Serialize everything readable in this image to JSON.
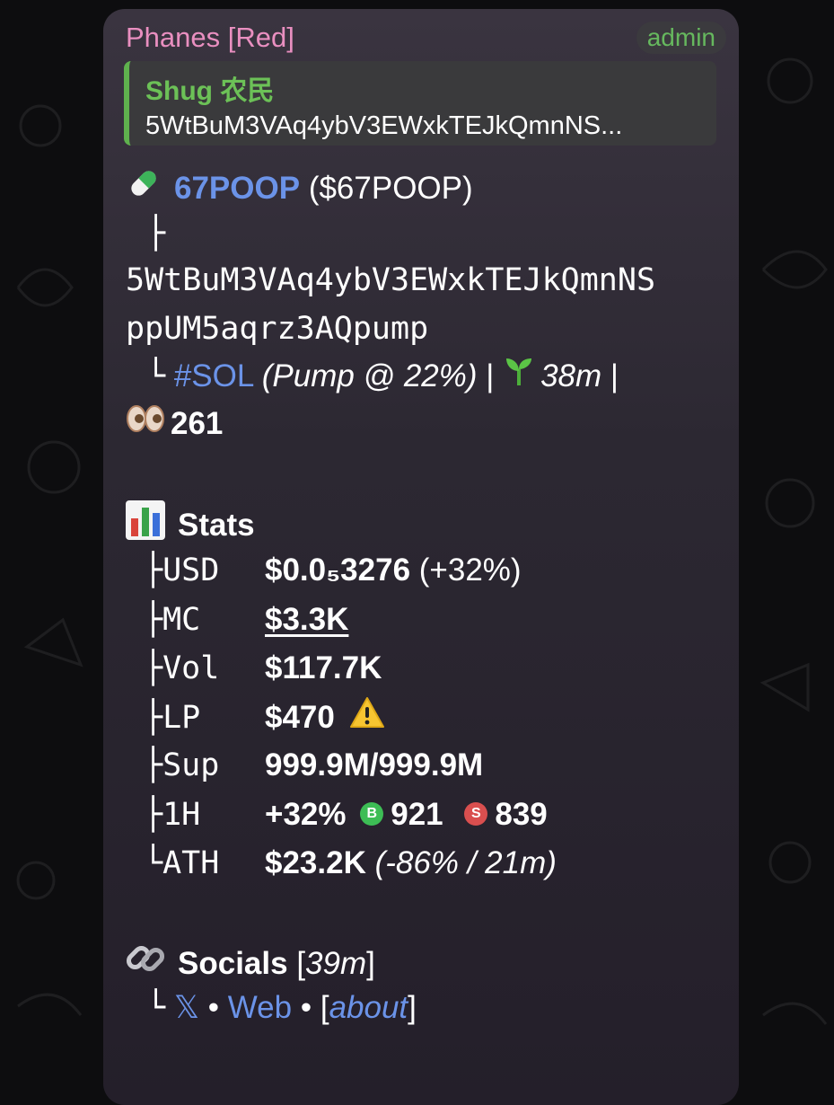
{
  "message": {
    "sender": "Phanes [Red]",
    "badge": "admin",
    "reply": {
      "name": "Shug 农民",
      "text": "5WtBuM3VAq4ybV3EWxkTEJkQmnNS..."
    },
    "token": {
      "name": "67POOP",
      "ticker": "($67POOP)",
      "branch": "├",
      "address_line1": "5WtBuM3VAq4ybV3EWxkTEJkQmnNS",
      "address_line2": "ppUM5aqrz3AQpump",
      "chain_prefix": "└",
      "chain": "#SOL",
      "platform": "(Pump @ 22%)",
      "sep1": "|",
      "age": "38m",
      "sep2": "|",
      "views": "261"
    },
    "stats": {
      "title": "Stats",
      "rows": [
        {
          "prefix": "├",
          "key": "USD",
          "value": "$0.0₅3276",
          "extra": "(+32%)"
        },
        {
          "prefix": "├",
          "key": "MC",
          "value": "$3.3K"
        },
        {
          "prefix": "├",
          "key": "Vol",
          "value": "$117.7K"
        },
        {
          "prefix": "├",
          "key": "LP",
          "value": "$470"
        },
        {
          "prefix": "├",
          "key": "Sup",
          "value": "999.9M/999.9M"
        },
        {
          "prefix": "├",
          "key": "1H",
          "value": "+32%",
          "buy_letter": "B",
          "buys": "921",
          "sell_letter": "S",
          "sells": "839"
        },
        {
          "prefix": "└",
          "key": "ATH",
          "value": "$23.2K",
          "extra": "(-86% / 21m)"
        }
      ]
    },
    "socials": {
      "title": "Socials",
      "age_open": "[",
      "age": "39m",
      "age_close": "]",
      "prefix": "└",
      "x_label": "𝕏",
      "dot1": "•",
      "web_label": "Web",
      "dot2": "•",
      "about_open": "[",
      "about_label": "about",
      "about_close": "]"
    }
  },
  "icons": [
    "pill-icon",
    "seedling-icon",
    "eyes-icon",
    "bar-chart-icon",
    "warning-icon",
    "link-icon"
  ],
  "colors": {
    "link": "#6b93e8",
    "sender": "#e98fc0",
    "reply_accent": "#5fb14e",
    "buy": "#3dbd55",
    "sell": "#d94f4f"
  }
}
